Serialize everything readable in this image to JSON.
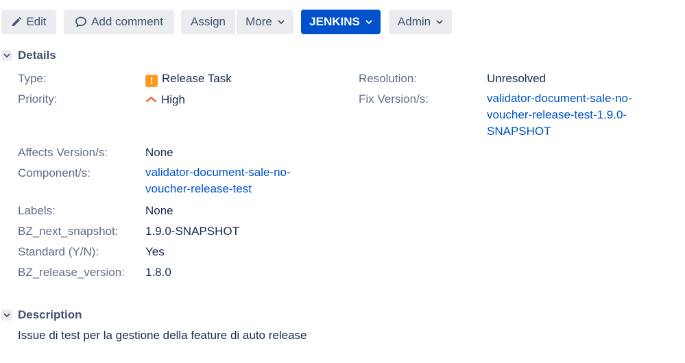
{
  "toolbar": {
    "edit": "Edit",
    "add_comment": "Add comment",
    "assign": "Assign",
    "more": "More",
    "jenkins": "JENKINS",
    "admin": "Admin"
  },
  "details": {
    "title": "Details",
    "left": {
      "type_label": "Type:",
      "type_value": "Release Task",
      "type_icon": "release-task-icon",
      "priority_label": "Priority:",
      "priority_value": "High",
      "priority_icon": "priority-high-icon",
      "affects_label": "Affects Version/s:",
      "affects_value": "None",
      "component_label": "Component/s:",
      "component_value": "validator-document-sale-no-voucher-release-test",
      "labels_label": "Labels:",
      "labels_value": "None",
      "bz_next_label": "BZ_next_snapshot:",
      "bz_next_value": "1.9.0-SNAPSHOT",
      "standard_label": "Standard (Y/N):",
      "standard_value": "Yes",
      "bz_release_label": "BZ_release_version:",
      "bz_release_value": "1.8.0"
    },
    "right": {
      "resolution_label": "Resolution:",
      "resolution_value": "Unresolved",
      "fix_label": "Fix Version/s:",
      "fix_value": "validator-document-sale-no-voucher-release-test-1.9.0-SNAPSHOT"
    }
  },
  "description": {
    "title": "Description",
    "text": "Issue di test per la gestione della feature di auto release"
  },
  "colors": {
    "primary": "#0052cc",
    "button_bg": "#ebecf0",
    "label": "#5e6c84",
    "text": "#172b4d",
    "priority": "#ff5630",
    "type_icon": "#ff991f"
  }
}
